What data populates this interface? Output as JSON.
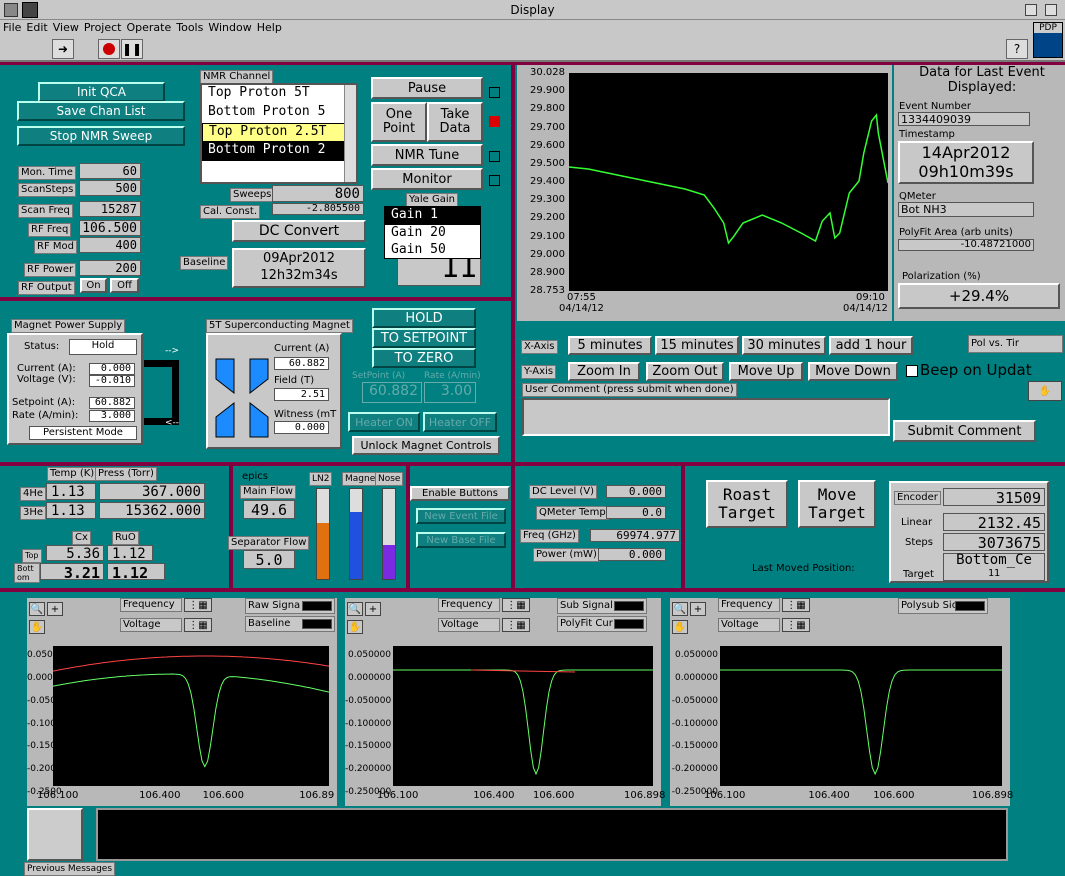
{
  "window": {
    "title": "Display"
  },
  "menu": [
    "File",
    "Edit",
    "View",
    "Project",
    "Operate",
    "Tools",
    "Window",
    "Help"
  ],
  "toolbar": {
    "pdp": "PDP"
  },
  "qca": {
    "init": "Init QCA",
    "save": "Save Chan List",
    "stop": "Stop NMR Sweep"
  },
  "nmr": {
    "label": "NMR Channel",
    "channels": [
      "Top Proton 5T",
      "Bottom Proton 5",
      "Top Proton 2.5T",
      "Bottom Proton 2"
    ],
    "mon_time": {
      "label": "Mon. Time",
      "value": "60"
    },
    "scan_steps": {
      "label": "ScanSteps",
      "value": "500"
    },
    "scan_freq": {
      "label": "Scan Freq",
      "value": "15287"
    },
    "rf_freq": {
      "label": "RF Freq",
      "value": "106.500"
    },
    "rf_mod": {
      "label": "RF Mod",
      "value": "400"
    },
    "rf_power": {
      "label": "RF Power",
      "value": "200"
    },
    "rf_output": {
      "label": "RF Output",
      "on": "On",
      "off": "Off"
    },
    "sweeps": {
      "label": "Sweeps",
      "value": "800"
    },
    "cal_const": {
      "label": "Cal. Const.",
      "value": "-2.805500"
    },
    "dc_convert": "DC Convert",
    "baseline": {
      "label": "Baseline",
      "date": "09Apr2012",
      "time": "12h32m34s"
    },
    "pause": "Pause",
    "one_point": "One Point",
    "take_data": "Take Data",
    "nmr_tune": "NMR Tune",
    "monitor": "Monitor",
    "yale_gain": {
      "label": "Yale Gain",
      "options": [
        "Gain 1",
        "Gain 20",
        "Gain 50"
      ],
      "value": "11"
    }
  },
  "event": {
    "title": "Data for Last Event Displayed:",
    "event_number": {
      "label": "Event Number",
      "value": "1334409039"
    },
    "timestamp": {
      "label": "Timestamp",
      "date": "14Apr2012",
      "time": "09h10m39s"
    },
    "qmeter": {
      "label": "QMeter",
      "value": "Bot NH3"
    },
    "polyfit": {
      "label": "PolyFit Area (arb units)",
      "value": "-10.48721000"
    },
    "polarization": {
      "label": "Polarization (%)",
      "value": "+29.4%"
    }
  },
  "polchart": {
    "yticks": [
      "30.028",
      "29.900",
      "29.800",
      "29.700",
      "29.600",
      "29.500",
      "29.400",
      "29.300",
      "29.200",
      "29.100",
      "29.000",
      "28.900",
      "28.753"
    ],
    "xstart": "07:55",
    "xstart_date": "04/14/12",
    "xend": "09:10",
    "xend_date": "04/14/12",
    "x_axis_label": "X-Axis",
    "y_axis_label": "Y-Axis",
    "x_buttons": [
      "5 minutes",
      "15 minutes",
      "30 minutes",
      "add 1 hour"
    ],
    "y_buttons": [
      "Zoom In",
      "Zoom Out",
      "Move Up",
      "Move Down"
    ],
    "pol_vs": "Pol vs. Tir",
    "beep": "Beep on Updat",
    "comment_label": "User Comment (press submit when done)",
    "submit": "Submit Comment"
  },
  "magnet": {
    "supply_label": "Magnet Power Supply",
    "status_label": "Status:",
    "status": "Hold",
    "current_label": "Current (A):",
    "current": "0.000",
    "voltage_label": "Voltage (V):",
    "voltage": "-0.010",
    "setpoint_label": "Setpoint (A):",
    "setpoint": "60.882",
    "rate_label": "Rate (A/min):",
    "rate": "3.000",
    "persistent": "Persistent Mode",
    "sc_label": "5T Superconducting Magnet",
    "sc_current_label": "Current (A)",
    "sc_current": "60.882",
    "field_label": "Field (T)",
    "field": "2.51",
    "witness_label": "Witness (mT",
    "witness": "0.000",
    "hold": "HOLD",
    "to_setpoint": "TO SETPOINT",
    "to_zero": "TO ZERO",
    "sp_label": "SetPoint (A)",
    "rate2_label": "Rate (A/min)",
    "sp_value": "60.882",
    "rate_value": "3.00",
    "heater_on": "Heater ON",
    "heater_off": "Heater OFF",
    "unlock": "Unlock Magnet Controls"
  },
  "temps": {
    "temp_label": "Temp (K)",
    "press_label": "Press (Torr)",
    "he4": {
      "label": "4He",
      "temp": "1.13",
      "press": "367.000"
    },
    "he3": {
      "label": "3He",
      "temp": "1.13",
      "press": "15362.000"
    },
    "cx": "Cx",
    "ruo": "RuO",
    "top_label": "Top",
    "top_cx": "5.36",
    "top_ruo": "1.12",
    "bot_label": "Bott om",
    "bot_cx": "3.21",
    "bot_ruo": "1.12"
  },
  "flows": {
    "epics": "epics",
    "main_label": "Main Flow",
    "main": "49.6",
    "sep_label": "Separator Flow",
    "sep": "5.0",
    "bars": [
      {
        "name": "LN2",
        "fill": 0.62,
        "color": "#e07010"
      },
      {
        "name": "Magnet",
        "fill": 0.75,
        "color": "#2050e0"
      },
      {
        "name": "Nose",
        "fill": 0.38,
        "color": "#7a2ae0"
      }
    ]
  },
  "enable": {
    "enable": "Enable Buttons",
    "new_event": "New Event File",
    "new_base": "New Base File"
  },
  "meter": {
    "dc_level": {
      "label": "DC Level (V)",
      "value": "0.000"
    },
    "qmeter_temp": {
      "label": "QMeter Temp",
      "value": "0.0"
    },
    "freq": {
      "label": "Freq (GHz)",
      "value": "69974.977"
    },
    "power": {
      "label": "Power (mW)",
      "value": "0.000"
    }
  },
  "target": {
    "roast": "Roast Target",
    "move": "Move Target",
    "encoder_label": "Encoder",
    "encoder": "31509",
    "linear_label": "Linear",
    "linear": "2132.45",
    "steps_label": "Steps",
    "steps": "3073675",
    "target_label": "Target",
    "target": "Bottom_Ce",
    "target_sub": "11",
    "last_moved": "Last Moved Position:"
  },
  "graphs": [
    {
      "sel1": "Frequency",
      "sel2": "Voltage",
      "legend": [
        "Raw Signa",
        "Baseline"
      ],
      "ticks_y": [
        "0.0500",
        "0.0000",
        "-0.0500",
        "-0.1000",
        "-0.1500",
        "-0.2000",
        "-0.2500"
      ],
      "ticks_x": [
        "106.100",
        "106.400",
        "106.600",
        "106.89"
      ]
    },
    {
      "sel1": "Frequency",
      "sel2": "Voltage",
      "legend": [
        "Sub Signal",
        "PolyFit Cur"
      ],
      "ticks_y": [
        "0.050000",
        "0.000000",
        "-0.050000",
        "-0.100000",
        "-0.150000",
        "-0.200000",
        "-0.250000"
      ],
      "ticks_x": [
        "106.100",
        "106.400",
        "106.600",
        "106.898"
      ]
    },
    {
      "sel1": "Frequency",
      "sel2": "Voltage",
      "legend": [
        "Polysub Sic"
      ],
      "ticks_y": [
        "0.050000",
        "0.000000",
        "-0.050000",
        "-0.100000",
        "-0.150000",
        "-0.200000",
        "-0.250000"
      ],
      "ticks_x": [
        "106.100",
        "106.400",
        "106.600",
        "106.898"
      ]
    }
  ],
  "messages": {
    "label": "Previous Messages"
  }
}
